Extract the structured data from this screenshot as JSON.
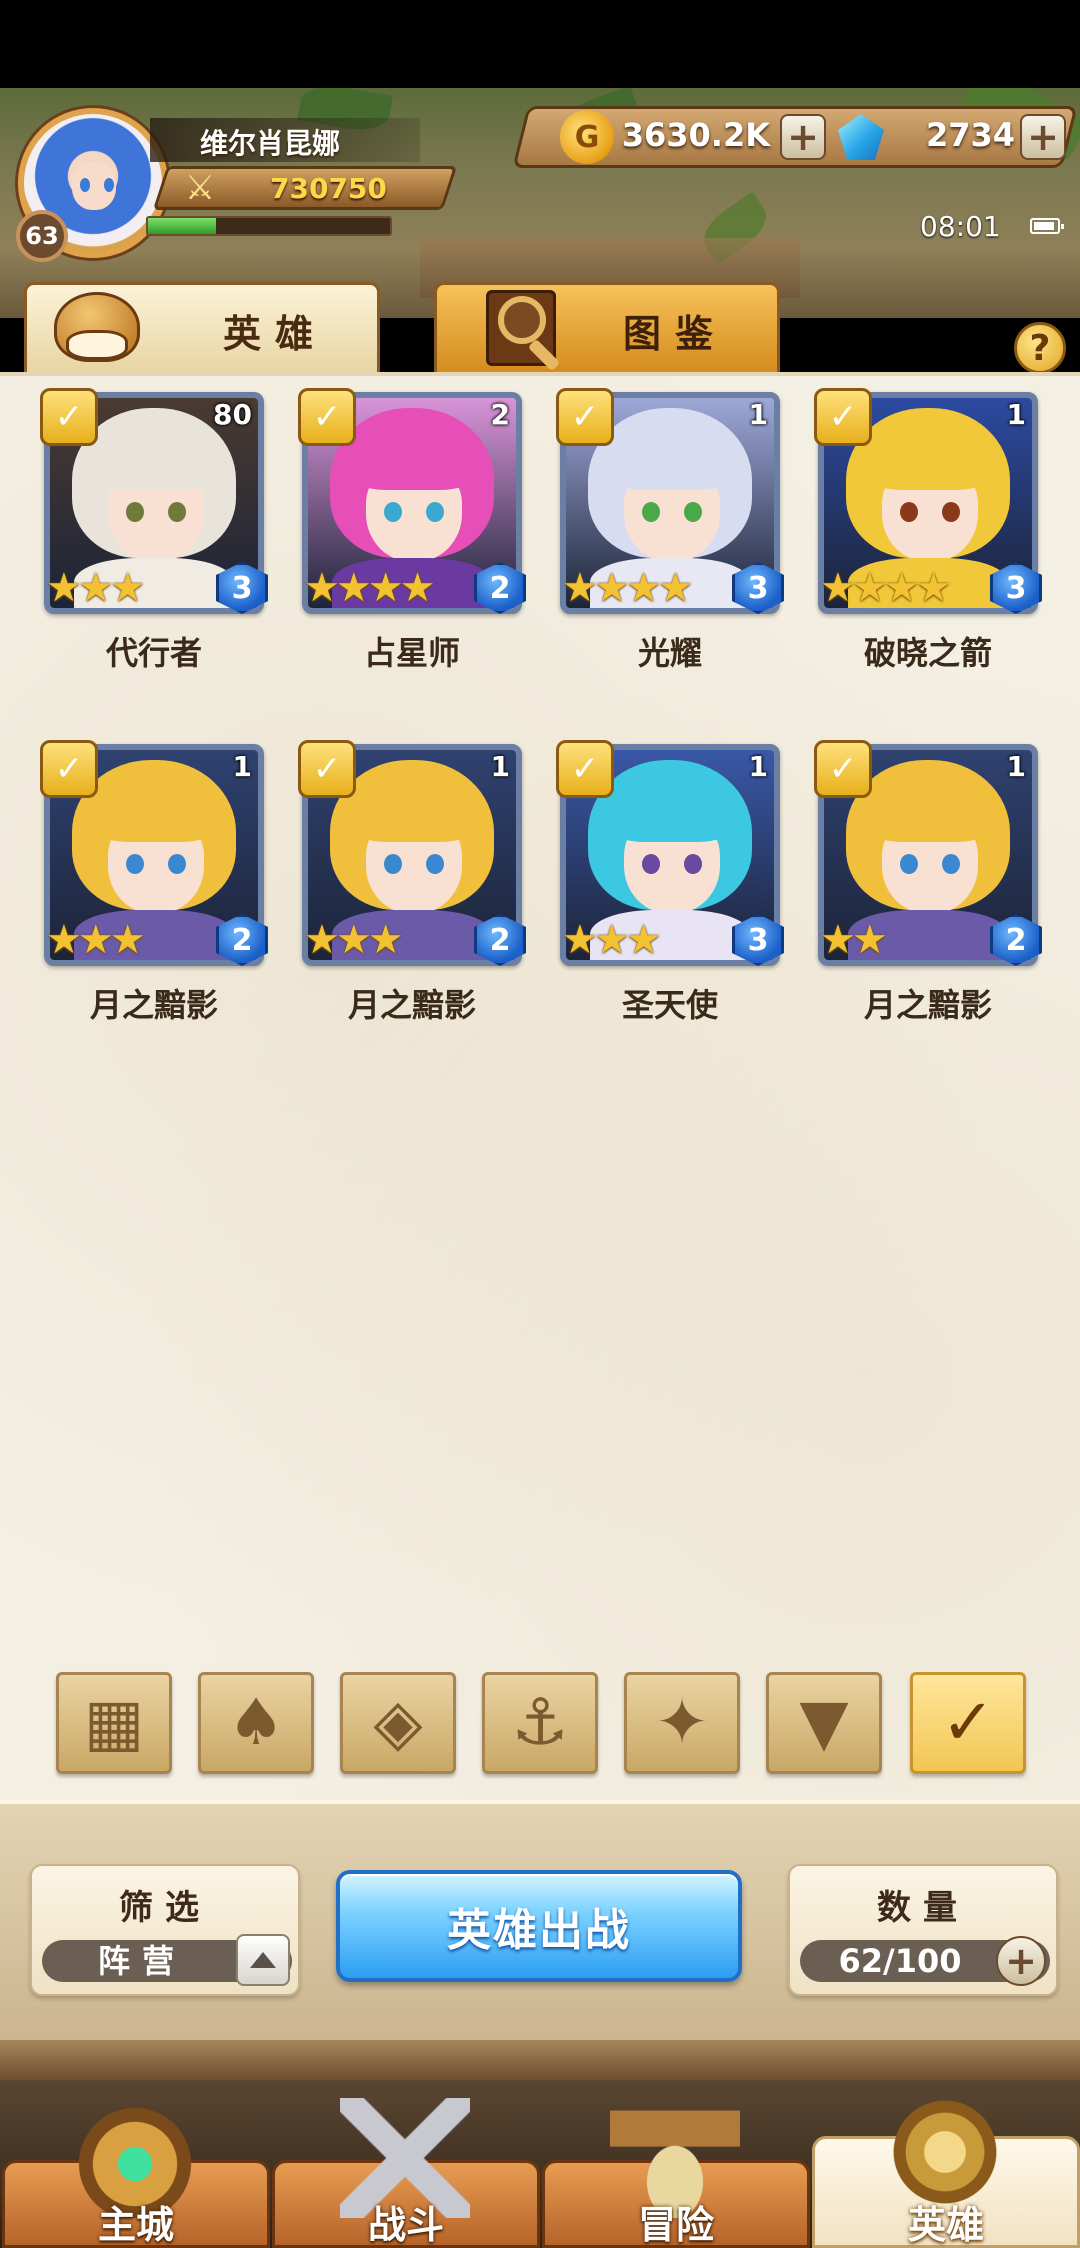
{
  "player": {
    "name": "维尔肖昆娜",
    "level": "63",
    "power": "730750",
    "exp_fraction": 0.28
  },
  "currency": {
    "gold": "3630.2K",
    "gems": "2734",
    "gold_icon_glyph": "G"
  },
  "status": {
    "time": "08:01"
  },
  "tabs": [
    {
      "label": "英雄",
      "icon": "helmet-icon",
      "active": true
    },
    {
      "label": "图鉴",
      "icon": "magnifier-icon",
      "active": false
    }
  ],
  "help": {
    "label": "?"
  },
  "heroes": [
    {
      "name": "代行者",
      "level": "80",
      "stars": "★★★",
      "grade": "3",
      "hair": "#e8e4dc",
      "bg": "#4a3a32",
      "eye": "#6f7a3a",
      "collar": "#f0ece4"
    },
    {
      "name": "占星师",
      "level": "2",
      "stars": "★★★★",
      "grade": "2",
      "hair": "#e64fb8",
      "bg": "#d894d8",
      "eye": "#3aa8d0",
      "collar": "#6a3aa0"
    },
    {
      "name": "光耀",
      "level": "1",
      "stars": "★★★★",
      "grade": "3",
      "hair": "#d8dcf0",
      "bg": "#9ea8d8",
      "eye": "#4aa84a",
      "collar": "#e8e8f4"
    },
    {
      "name": "破晓之箭",
      "level": "1",
      "stars": "★★★★",
      "grade": "3",
      "hair": "#f0c83a",
      "bg": "#2c4aa0",
      "eye": "#8a3a1a",
      "collar": "#f0c83a"
    },
    {
      "name": "月之黯影",
      "level": "1",
      "stars": "★★★",
      "grade": "2",
      "hair": "#f0c03c",
      "bg": "#2f4270",
      "eye": "#3a88d0",
      "collar": "#6a5aa8"
    },
    {
      "name": "月之黯影",
      "level": "1",
      "stars": "★★★",
      "grade": "2",
      "hair": "#f0c03c",
      "bg": "#2f4270",
      "eye": "#3a88d0",
      "collar": "#6a5aa8"
    },
    {
      "name": "圣天使",
      "level": "1",
      "stars": "★★★",
      "grade": "3",
      "hair": "#3cc8e0",
      "bg": "#3a58a8",
      "eye": "#6a4aa0",
      "collar": "#e8e4f4"
    },
    {
      "name": "月之黯影",
      "level": "1",
      "stars": "★★",
      "grade": "2",
      "hair": "#f0c03c",
      "bg": "#2f4270",
      "eye": "#3a88d0",
      "collar": "#6a5aa8"
    }
  ],
  "filters": [
    {
      "icon": "grid-icon",
      "glyph": "▦",
      "active": false
    },
    {
      "icon": "flame-faction-icon",
      "glyph": "♠",
      "active": false
    },
    {
      "icon": "diamond-faction-icon",
      "glyph": "◈",
      "active": false
    },
    {
      "icon": "anchor-faction-icon",
      "glyph": "⚓",
      "active": false
    },
    {
      "icon": "beast-faction-icon",
      "glyph": "✦",
      "active": false
    },
    {
      "icon": "demon-faction-icon",
      "glyph": "▼",
      "active": false
    },
    {
      "icon": "light-faction-icon",
      "glyph": "✓",
      "active": true
    }
  ],
  "filter_panel": {
    "title": "筛选",
    "value": "阵营"
  },
  "deploy_button": {
    "label": "英雄出战"
  },
  "count_panel": {
    "title": "数量",
    "value": "62/100"
  },
  "plus_glyph": "+",
  "bottom_nav": [
    {
      "label": "主城",
      "icon": "castle-icon",
      "active": false
    },
    {
      "label": "战斗",
      "icon": "crossed-swords-icon",
      "active": false
    },
    {
      "label": "冒险",
      "icon": "adventure-map-icon",
      "active": false
    },
    {
      "label": "英雄",
      "icon": "hero-crest-icon",
      "active": true
    }
  ]
}
